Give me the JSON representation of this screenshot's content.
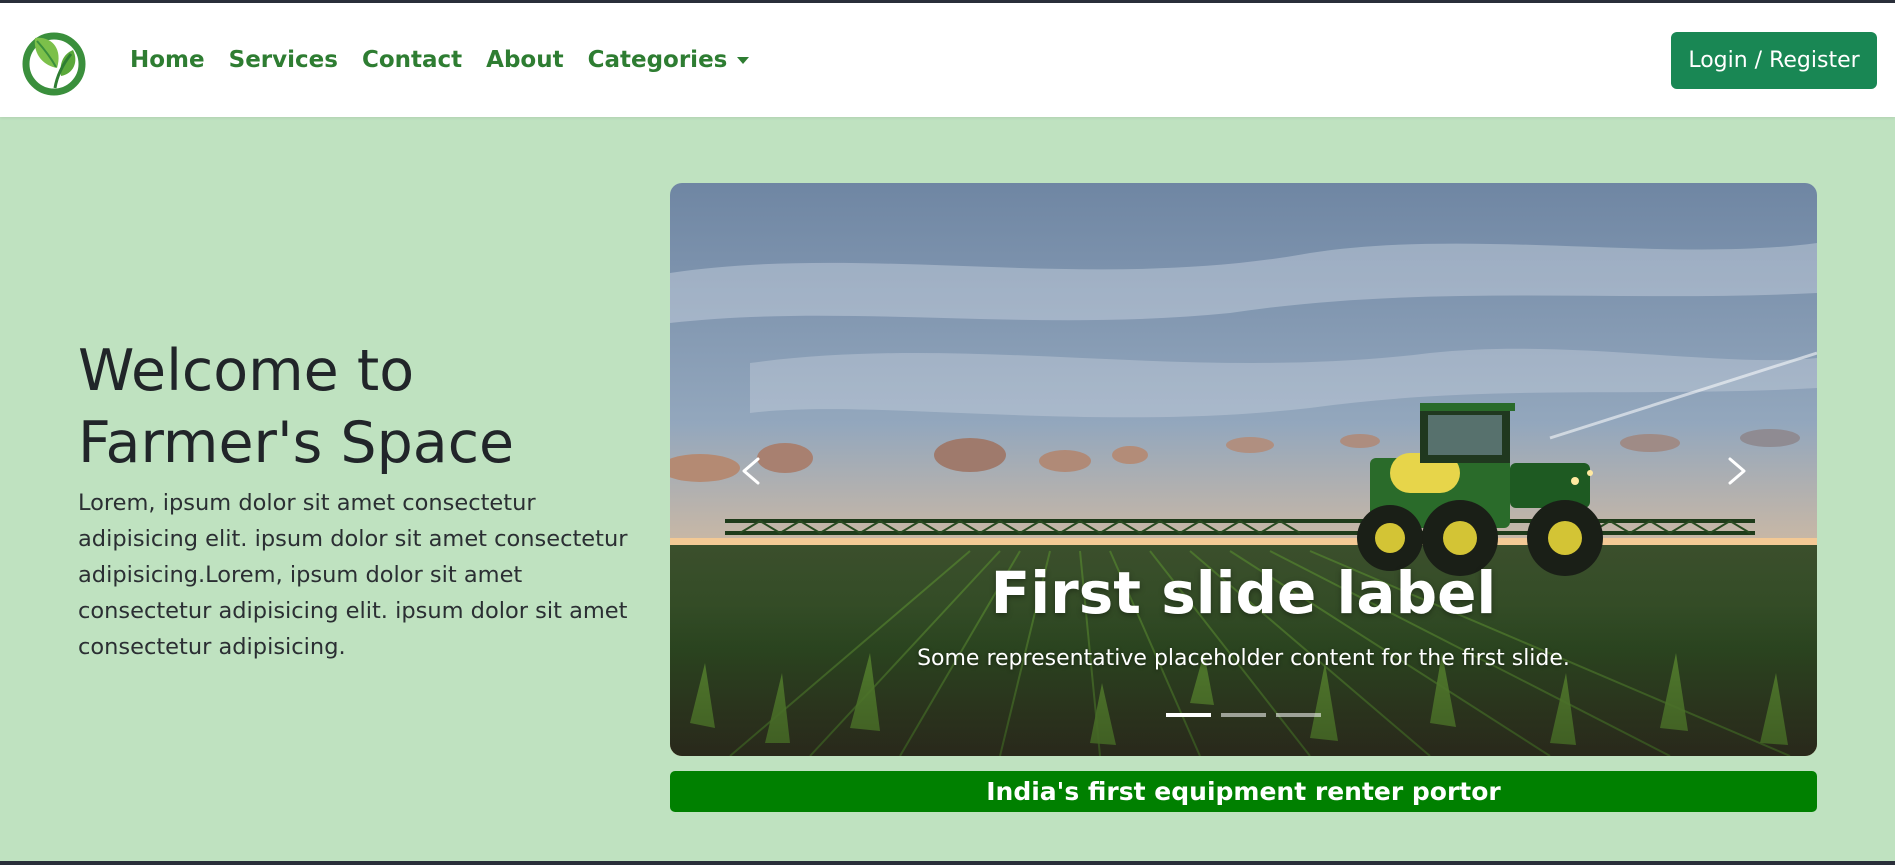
{
  "navbar": {
    "links": [
      {
        "label": "Home"
      },
      {
        "label": "Services"
      },
      {
        "label": "Contact"
      },
      {
        "label": "About"
      },
      {
        "label": "Categories"
      }
    ],
    "login_label": "Login / Register",
    "logo_icon": "leaf-logo-icon"
  },
  "hero": {
    "title_line1": "Welcome to",
    "title_line2": "Farmer's Space",
    "description": "Lorem, ipsum dolor sit amet consectetur adipisicing elit. ipsum dolor sit amet consectetur adipisicing.Lorem, ipsum dolor sit amet consectetur adipisicing elit. ipsum dolor sit amet consectetur adipisicing."
  },
  "carousel": {
    "caption_title": "First slide label",
    "caption_text": "Some representative placeholder content for the first slide.",
    "slide_count": 3,
    "active_slide": 1,
    "prev_icon": "chevron-left-icon",
    "next_icon": "chevron-right-icon"
  },
  "banner": {
    "text": "India's first equipment renter portor"
  },
  "colors": {
    "page_background": "#bfe2c0",
    "nav_link": "#2e7d32",
    "login_button": "#198754",
    "banner": "#008000"
  }
}
